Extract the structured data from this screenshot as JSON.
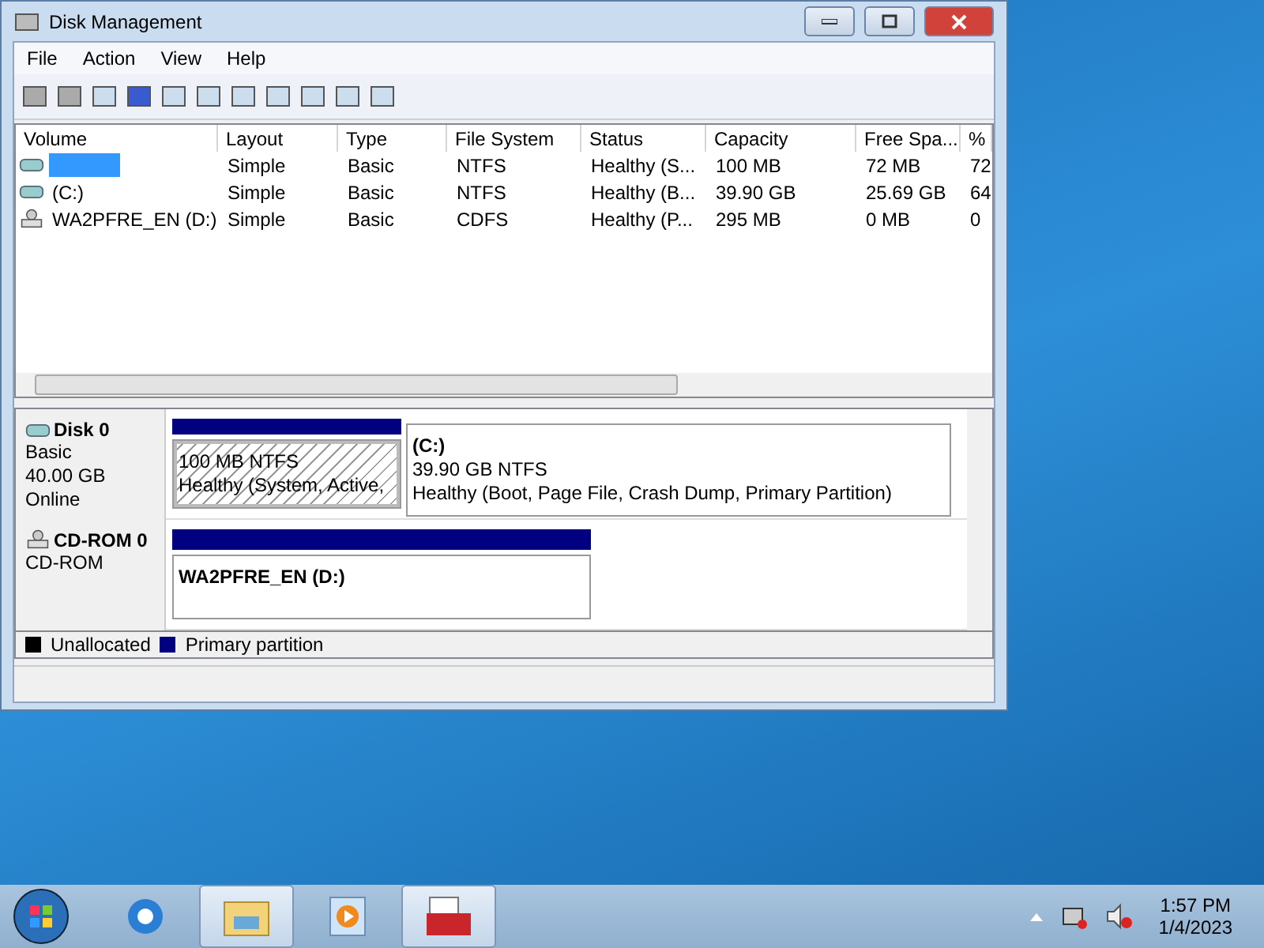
{
  "window": {
    "title": "Disk Management"
  },
  "menu": [
    "File",
    "Action",
    "View",
    "Help"
  ],
  "table": {
    "columns": [
      "Volume",
      "Layout",
      "Type",
      "File System",
      "Status",
      "Capacity",
      "Free Spa...",
      "%"
    ],
    "rows": [
      {
        "kind": "hdd",
        "selected": true,
        "cells": [
          "",
          "Simple",
          "Basic",
          "NTFS",
          "Healthy (S...",
          "100 MB",
          "72 MB",
          "72"
        ]
      },
      {
        "kind": "hdd",
        "selected": false,
        "cells": [
          "(C:)",
          "Simple",
          "Basic",
          "NTFS",
          "Healthy (B...",
          "39.90 GB",
          "25.69 GB",
          "64"
        ]
      },
      {
        "kind": "cd",
        "selected": false,
        "cells": [
          "WA2PFRE_EN (D:)",
          "Simple",
          "Basic",
          "CDFS",
          "Healthy (P...",
          "295 MB",
          "0 MB",
          "0"
        ]
      }
    ]
  },
  "disks": [
    {
      "kind": "hdd",
      "name": "Disk 0",
      "lines": [
        "Basic",
        "40.00 GB",
        "Online"
      ],
      "partitions": [
        {
          "selected": true,
          "lines": [
            "100 MB NTFS",
            "Healthy (System, Active,"
          ]
        },
        {
          "selected": false,
          "title": "(C:)",
          "lines": [
            "39.90 GB NTFS",
            "Healthy (Boot, Page File, Crash Dump, Primary Partition)"
          ]
        }
      ]
    },
    {
      "kind": "cd",
      "name": "CD-ROM 0",
      "lines": [
        "CD-ROM"
      ],
      "partitions": [
        {
          "selected": false,
          "title": "WA2PFRE_EN  (D:)"
        }
      ]
    }
  ],
  "legend": [
    {
      "label": "Unallocated",
      "color": "#000000"
    },
    {
      "label": "Primary partition",
      "color": "#000080"
    }
  ],
  "taskbar": {
    "apps": [
      {
        "kind": "ie",
        "active": false
      },
      {
        "kind": "explorer",
        "active": true
      },
      {
        "kind": "media",
        "active": false
      },
      {
        "kind": "toolbox",
        "active": true
      }
    ],
    "time": "1:57 PM",
    "date": "1/4/2023"
  }
}
